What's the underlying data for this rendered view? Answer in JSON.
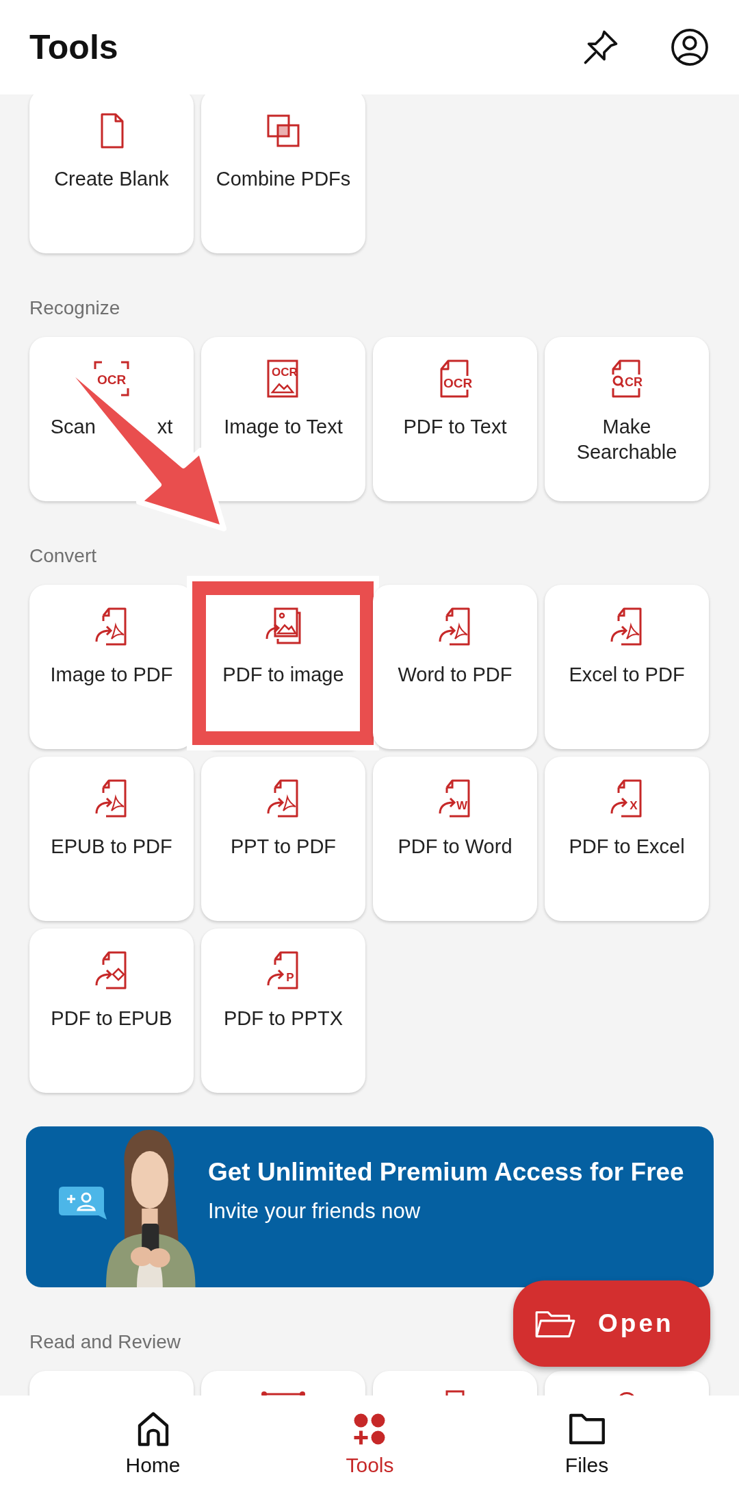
{
  "header": {
    "title": "Tools"
  },
  "sections": [
    {
      "tools": [
        {
          "label": "Create Blank",
          "kind": "page",
          "highlighted": false
        },
        {
          "label": "Combine PDFs",
          "kind": "combine",
          "highlighted": false
        }
      ]
    },
    {
      "title": "Recognize",
      "tools": [
        {
          "label": "Scan",
          "label_end": "xt",
          "kind": "scan-ocr",
          "icon_text": "OCR",
          "highlighted": false
        },
        {
          "label": "Image to Text",
          "kind": "image-ocr",
          "icon_text": "OCR",
          "highlighted": false
        },
        {
          "label": "PDF to Text",
          "kind": "doc-ocr",
          "icon_text": "OCR",
          "highlighted": false
        },
        {
          "label": "Make Searchable",
          "kind": "search-ocr",
          "icon_text": "CR",
          "highlighted": false
        }
      ]
    },
    {
      "title": "Convert",
      "tools": [
        {
          "label": "Image to PDF",
          "kind": "convert-pdf",
          "highlighted": false
        },
        {
          "label": "PDF to image",
          "kind": "convert-image",
          "highlighted": true
        },
        {
          "label": "Word to PDF",
          "kind": "convert-pdf",
          "highlighted": false
        },
        {
          "label": "Excel to PDF",
          "kind": "convert-pdf",
          "highlighted": false
        },
        {
          "label": "EPUB to PDF",
          "kind": "convert-pdf",
          "highlighted": false
        },
        {
          "label": "PPT to PDF",
          "kind": "convert-pdf",
          "highlighted": false
        },
        {
          "label": "PDF to Word",
          "kind": "convert-letter",
          "icon_text": "W",
          "highlighted": false
        },
        {
          "label": "PDF to Excel",
          "kind": "convert-letter",
          "icon_text": "X",
          "highlighted": false
        },
        {
          "label": "PDF to EPUB",
          "kind": "convert-epub",
          "highlighted": false
        },
        {
          "label": "PDF to PPTX",
          "kind": "convert-letter",
          "icon_text": "P",
          "highlighted": false
        }
      ]
    }
  ],
  "banner": {
    "title": "Get Unlimited Premium Access for Free",
    "subtitle": "Invite your friends now"
  },
  "lower_section": {
    "title": "Read and Review",
    "tools": [
      {
        "kind": "blank"
      },
      {
        "kind": "crop"
      },
      {
        "kind": "page-top"
      },
      {
        "kind": "pin-top"
      }
    ]
  },
  "fab": {
    "label": "Open"
  },
  "nav": [
    {
      "label": "Home",
      "kind": "home",
      "selected": false
    },
    {
      "label": "Tools",
      "kind": "tools",
      "selected": true
    },
    {
      "label": "Files",
      "kind": "folder",
      "selected": false
    }
  ]
}
